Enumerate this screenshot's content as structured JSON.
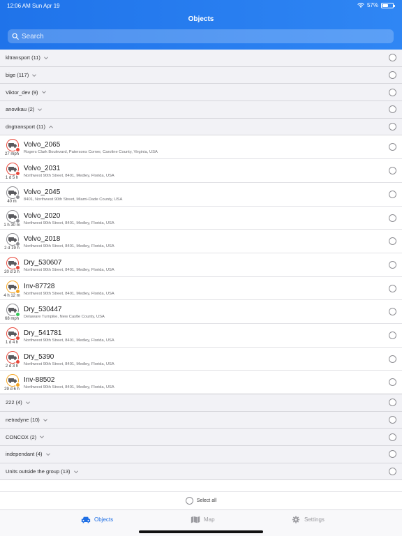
{
  "status": {
    "time": "12:06 AM",
    "date": "Sun Apr 19",
    "battery": "57%",
    "battery_level": 0.57
  },
  "header": {
    "title": "Objects"
  },
  "search": {
    "placeholder": "Search"
  },
  "colors": {
    "accent": "#1f73ea",
    "red": "#e8483b",
    "orange": "#f5a623",
    "gray": "#8e8e93",
    "green": "#35c759"
  },
  "groups_top": [
    {
      "label": "kltransport (11)",
      "expanded": false
    },
    {
      "label": "bige (117)",
      "expanded": false
    },
    {
      "label": "Viktor_dev (9)",
      "expanded": false
    },
    {
      "label": "anovikau (2)",
      "expanded": false
    },
    {
      "label": "dngtransport (11)",
      "expanded": true
    }
  ],
  "items": [
    {
      "name": "Volvo_2065",
      "meta": "27 mph",
      "address": "Rogers Clark Boulevard, Patersons Corner, Caroline County, Virginia, USA",
      "ring": "#e8483b",
      "badge": "#e8483b"
    },
    {
      "name": "Volvo_2031",
      "meta": "1 d 5 h",
      "address": "Northwest 90th Street, 8401, Medley, Florida, USA",
      "ring": "#e8483b",
      "badge": "#e8483b"
    },
    {
      "name": "Volvo_2045",
      "meta": "40 m",
      "address": "8401, Northwest 90th Street, Miami-Dade County, USA",
      "ring": "#8e8e93",
      "badge": "#8e8e93"
    },
    {
      "name": "Volvo_2020",
      "meta": "1 h 30 m",
      "address": "Northwest 90th Street, 8401, Medley, Florida, USA",
      "ring": "#8e8e93",
      "badge": "#8e8e93"
    },
    {
      "name": "Volvo_2018",
      "meta": "2 d 19 h",
      "address": "Northwest 90th Street, 8401, Medley, Florida, USA",
      "ring": "#8e8e93",
      "badge": "#8e8e93"
    },
    {
      "name": "Dry_530607",
      "meta": "20 d 3 h",
      "address": "Northwest 90th Street, 8401, Medley, Florida, USA",
      "ring": "#e8483b",
      "badge": "#e8483b"
    },
    {
      "name": "Inv-87728",
      "meta": "4 h 12 m",
      "address": "Northwest 90th Street, 8401, Medley, Florida, USA",
      "ring": "#f5a623",
      "badge": "#f5a623"
    },
    {
      "name": "Dry_530447",
      "meta": "68 mph",
      "address": "Delaware Turnpike, New Castle County, USA",
      "ring": "#8e8e93",
      "badge": "#35c759"
    },
    {
      "name": "Dry_541781",
      "meta": "1 d 4 h",
      "address": "Northwest 90th Street, 8401, Medley, Florida, USA",
      "ring": "#e8483b",
      "badge": "#e8483b"
    },
    {
      "name": "Dry_5390",
      "meta": "2 d 3 h",
      "address": "Northwest 90th Street, 8401, Medley, Florida, USA",
      "ring": "#e8483b",
      "badge": "#e8483b"
    },
    {
      "name": "Inv-88502",
      "meta": "29 d 6 h",
      "address": "Northwest 90th Street, 8401, Medley, Florida, USA",
      "ring": "#f5a623",
      "badge": "#f5a623"
    }
  ],
  "groups_bottom": [
    {
      "label": "222 (4)",
      "expanded": false
    },
    {
      "label": "netradyne (10)",
      "expanded": false
    },
    {
      "label": "CONCOX (2)",
      "expanded": false
    },
    {
      "label": "independant (4)",
      "expanded": false
    },
    {
      "label": "Units outside the group (13)",
      "expanded": false
    }
  ],
  "select_all": {
    "label": "Select all"
  },
  "tabs": {
    "objects": "Objects",
    "map": "Map",
    "settings": "Settings"
  }
}
